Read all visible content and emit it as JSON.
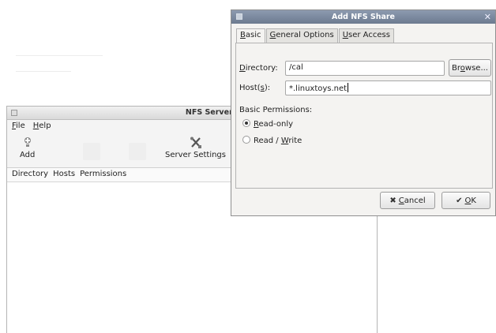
{
  "main_window": {
    "title": "NFS Server Configuration",
    "menu": [
      {
        "mnemonic": "F",
        "rest": "ile"
      },
      {
        "mnemonic": "H",
        "rest": "elp"
      }
    ],
    "toolbar": {
      "add_label": "Add",
      "add_icon": "plus-icon",
      "server_settings_label": "Server Settings",
      "server_settings_icon": "tools-icon"
    },
    "columns": [
      "Directory",
      "Hosts",
      "Permissions"
    ]
  },
  "dialog": {
    "title": "Add NFS Share",
    "tabs": [
      {
        "mnemonic": "B",
        "rest": "asic"
      },
      {
        "mnemonic": "G",
        "rest": "eneral Options"
      },
      {
        "mnemonic": "U",
        "rest": "ser Access"
      }
    ],
    "directory": {
      "mnemonic": "D",
      "rest": "irectory:",
      "value": "/cal"
    },
    "browse": {
      "pre": "Br",
      "mnemonic": "o",
      "rest": "wse..."
    },
    "hosts": {
      "pre": "Host(",
      "mnemonic": "s",
      "rest": "):",
      "value": "*.linuxtoys.net"
    },
    "permissions_heading": "Basic Permissions:",
    "read_only": {
      "mnemonic": "R",
      "rest": "ead-only",
      "selected": true
    },
    "read_write": {
      "pre": "Read / ",
      "mnemonic": "W",
      "rest": "rite",
      "selected": false
    },
    "cancel": {
      "mnemonic": "C",
      "rest": "ancel",
      "icon": "x-cancel-icon"
    },
    "ok": {
      "mnemonic": "O",
      "rest": "K",
      "icon": "ok-icon"
    }
  }
}
